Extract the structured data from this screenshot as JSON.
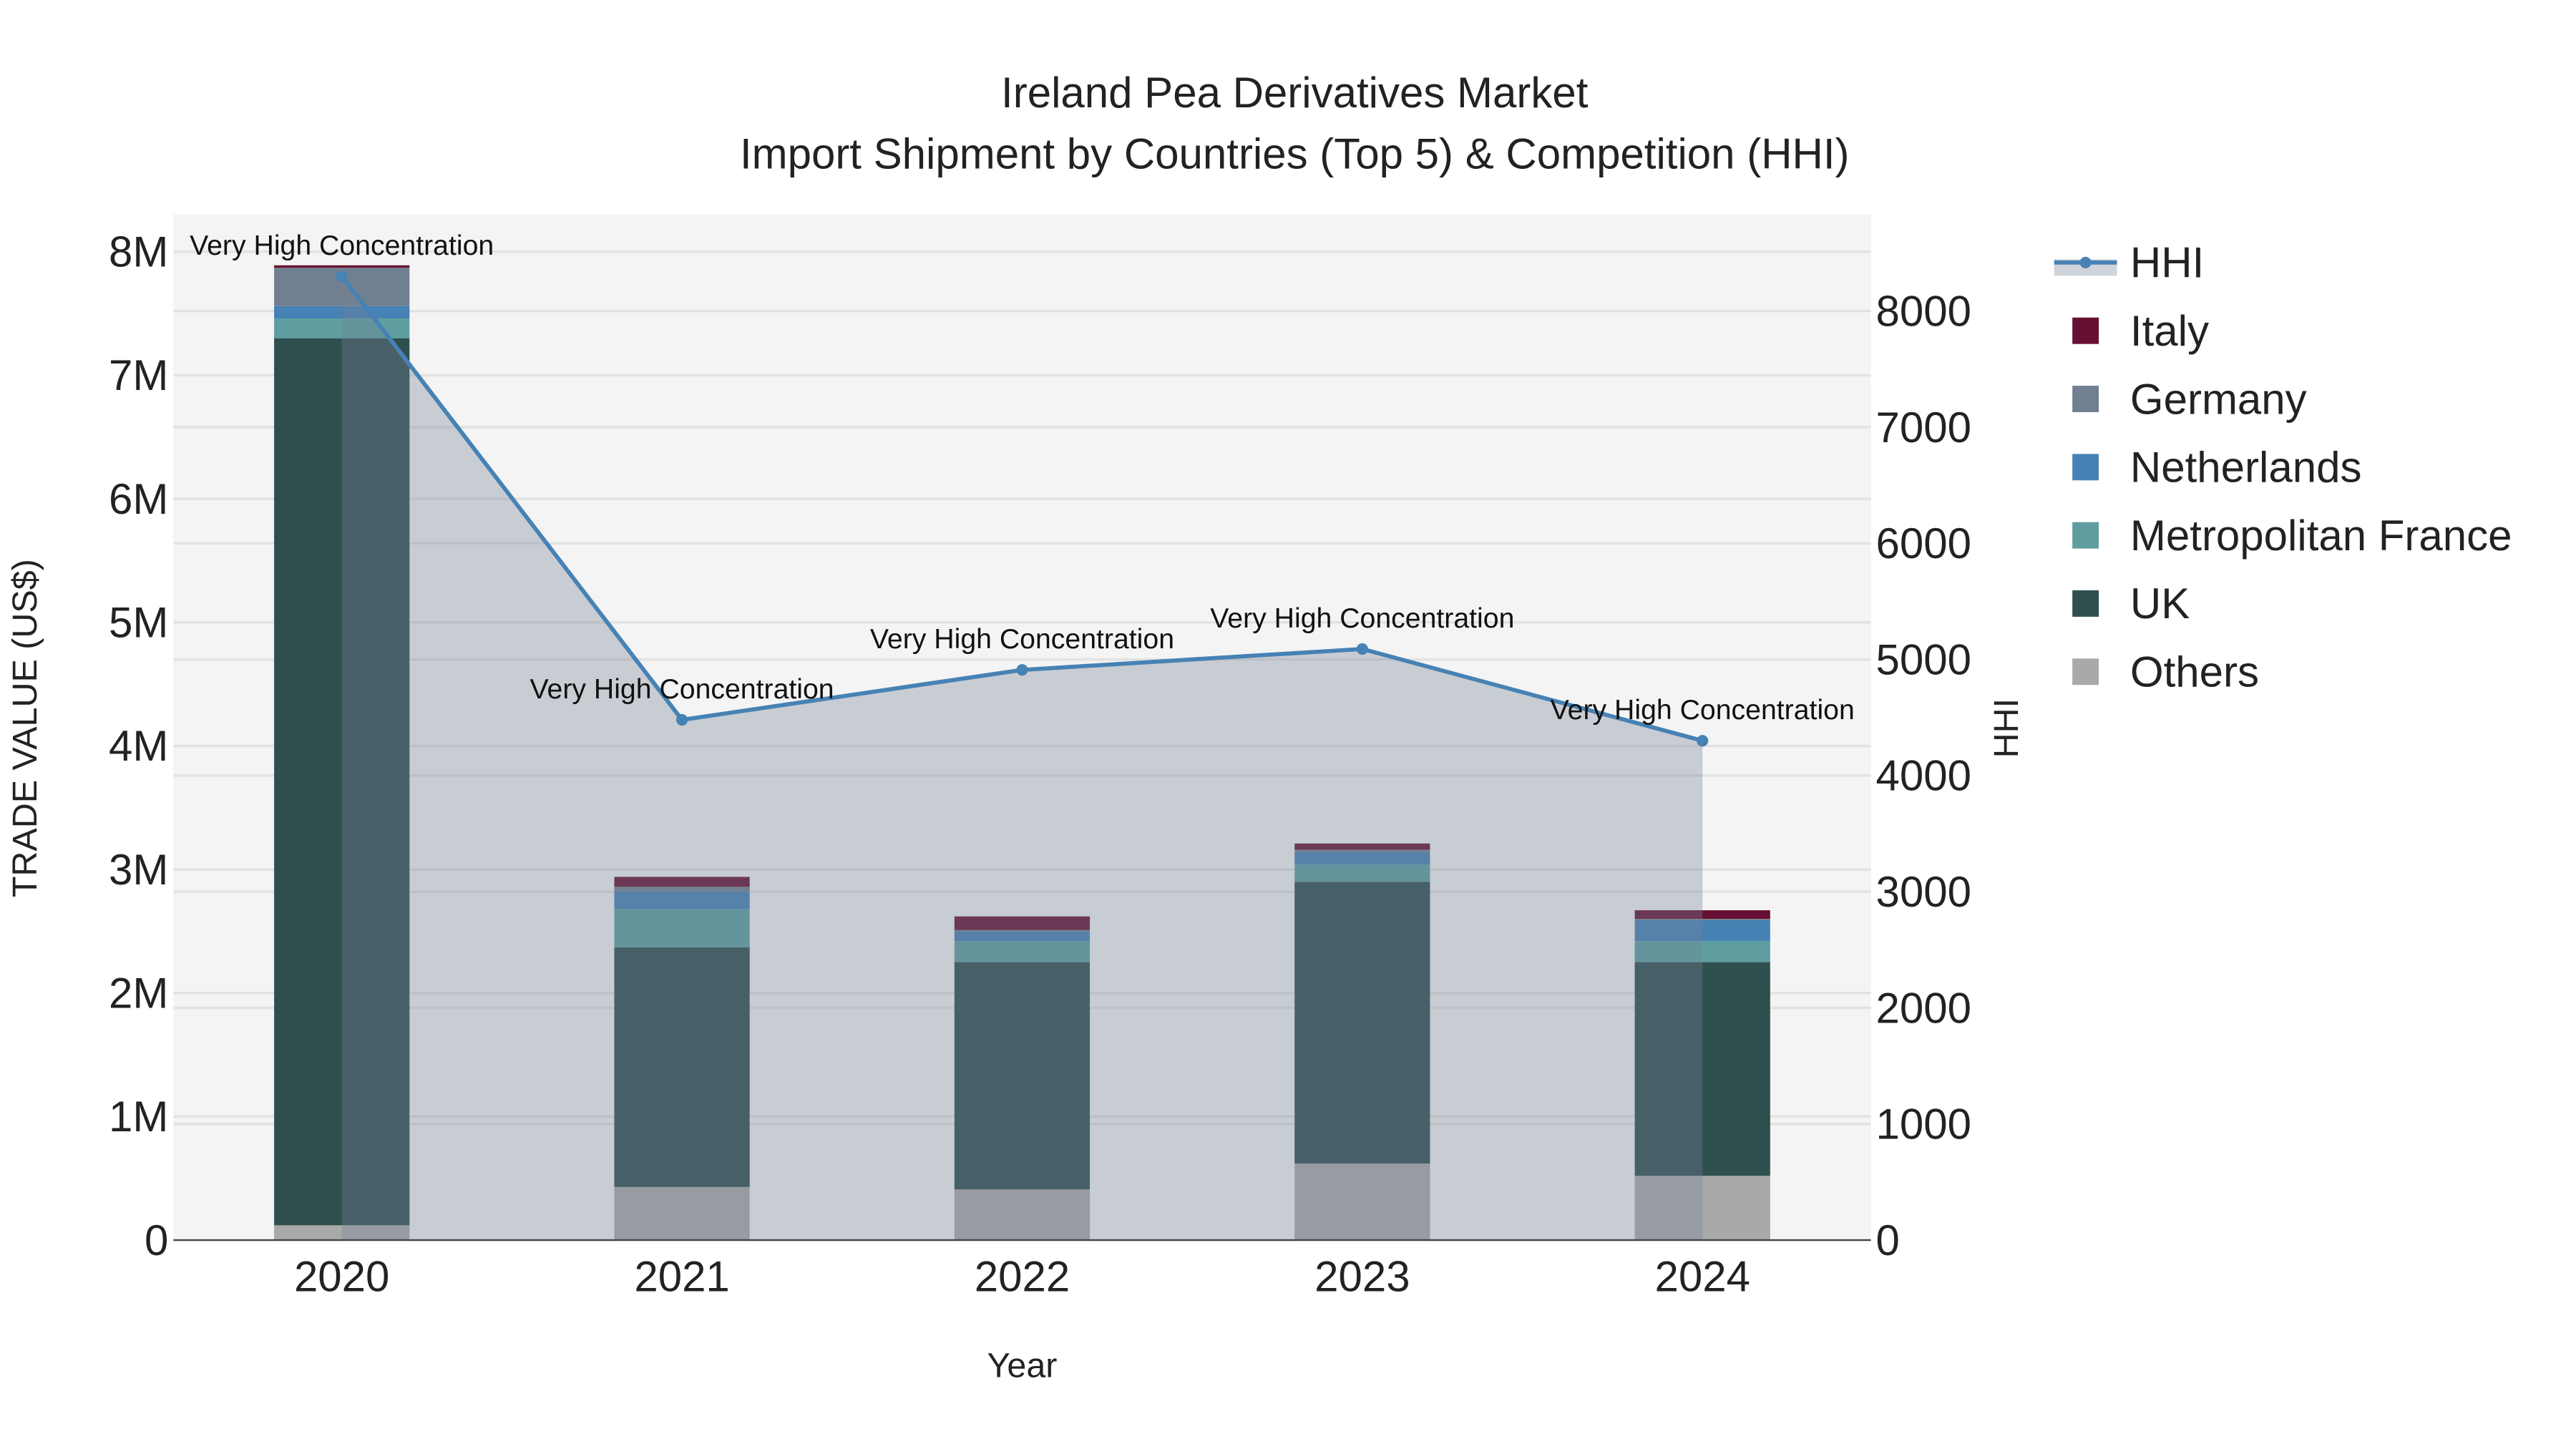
{
  "chart_data": {
    "type": "bar",
    "title_line1": "Ireland Pea Derivatives Market",
    "title_line2": "Import Shipment by Countries (Top 5) & Competition (HHI)",
    "xlabel": "Year",
    "ylabel": "TRADE VALUE (US$)",
    "y2label": "HHI",
    "categories": [
      "2020",
      "2021",
      "2022",
      "2023",
      "2024"
    ],
    "ylim": [
      0,
      8300000
    ],
    "y2lim": [
      0,
      8830
    ],
    "yticks": [
      {
        "v": 0,
        "l": "0"
      },
      {
        "v": 1000000,
        "l": "1M"
      },
      {
        "v": 2000000,
        "l": "2M"
      },
      {
        "v": 3000000,
        "l": "3M"
      },
      {
        "v": 4000000,
        "l": "4M"
      },
      {
        "v": 5000000,
        "l": "5M"
      },
      {
        "v": 6000000,
        "l": "6M"
      },
      {
        "v": 7000000,
        "l": "7M"
      },
      {
        "v": 8000000,
        "l": "8M"
      }
    ],
    "y2ticks": [
      {
        "v": 0,
        "l": "0"
      },
      {
        "v": 1000,
        "l": "1000"
      },
      {
        "v": 2000,
        "l": "2000"
      },
      {
        "v": 3000,
        "l": "3000"
      },
      {
        "v": 4000,
        "l": "4000"
      },
      {
        "v": 5000,
        "l": "5000"
      },
      {
        "v": 6000,
        "l": "6000"
      },
      {
        "v": 7000,
        "l": "7000"
      },
      {
        "v": 8000,
        "l": "8000"
      }
    ],
    "series": [
      {
        "name": "Others",
        "color": "#a9a9a9",
        "values": [
          120000,
          430000,
          410000,
          620000,
          520000
        ]
      },
      {
        "name": "UK",
        "color": "#2f4f4f",
        "values": [
          7180000,
          1940000,
          1840000,
          2280000,
          1730000
        ]
      },
      {
        "name": "Metropolitan France",
        "color": "#5f9ea0",
        "values": [
          160000,
          310000,
          170000,
          140000,
          170000
        ]
      },
      {
        "name": "Netherlands",
        "color": "#4682b4",
        "values": [
          100000,
          140000,
          80000,
          100000,
          170000
        ]
      },
      {
        "name": "Germany",
        "color": "#708090",
        "values": [
          310000,
          40000,
          10000,
          20000,
          10000
        ]
      },
      {
        "name": "Italy",
        "color": "#661133",
        "values": [
          20000,
          80000,
          110000,
          50000,
          70000
        ]
      }
    ],
    "hhi": {
      "name": "HHI",
      "color": "#4682b4",
      "values": [
        8300,
        4480,
        4910,
        5090,
        4300
      ],
      "labels": [
        "Very High Concentration",
        "Very High Concentration",
        "Very High Concentration",
        "Very High Concentration",
        "Very High Concentration"
      ]
    },
    "legend_order": [
      "HHI",
      "Italy",
      "Germany",
      "Netherlands",
      "Metropolitan France",
      "UK",
      "Others"
    ],
    "legend_position": "right"
  }
}
